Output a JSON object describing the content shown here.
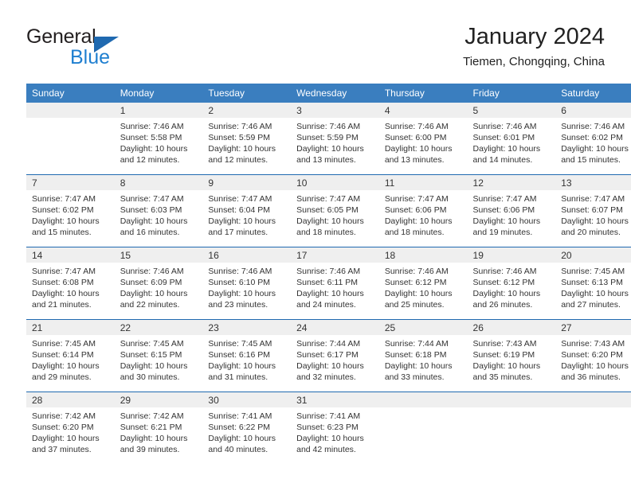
{
  "brand": {
    "name_part1": "General",
    "name_part2": "Blue",
    "triangle_color": "#1f69b0",
    "blue_color": "#1f7fd0"
  },
  "header": {
    "title": "January 2024",
    "subtitle": "Tiemen, Chongqing, China"
  },
  "theme": {
    "header_row_bg": "#3a7ebf",
    "header_row_text": "#ffffff",
    "daynum_band_bg": "#efefef",
    "row_divider": "#1f69b0",
    "body_text": "#333333"
  },
  "weekday_headers": [
    "Sunday",
    "Monday",
    "Tuesday",
    "Wednesday",
    "Thursday",
    "Friday",
    "Saturday"
  ],
  "weeks": [
    [
      {
        "day": "",
        "sunrise": "",
        "sunset": "",
        "daylight_line1": "",
        "daylight_line2": "",
        "empty": true
      },
      {
        "day": "1",
        "sunrise": "Sunrise: 7:46 AM",
        "sunset": "Sunset: 5:58 PM",
        "daylight_line1": "Daylight: 10 hours",
        "daylight_line2": "and 12 minutes.",
        "empty": false
      },
      {
        "day": "2",
        "sunrise": "Sunrise: 7:46 AM",
        "sunset": "Sunset: 5:59 PM",
        "daylight_line1": "Daylight: 10 hours",
        "daylight_line2": "and 12 minutes.",
        "empty": false
      },
      {
        "day": "3",
        "sunrise": "Sunrise: 7:46 AM",
        "sunset": "Sunset: 5:59 PM",
        "daylight_line1": "Daylight: 10 hours",
        "daylight_line2": "and 13 minutes.",
        "empty": false
      },
      {
        "day": "4",
        "sunrise": "Sunrise: 7:46 AM",
        "sunset": "Sunset: 6:00 PM",
        "daylight_line1": "Daylight: 10 hours",
        "daylight_line2": "and 13 minutes.",
        "empty": false
      },
      {
        "day": "5",
        "sunrise": "Sunrise: 7:46 AM",
        "sunset": "Sunset: 6:01 PM",
        "daylight_line1": "Daylight: 10 hours",
        "daylight_line2": "and 14 minutes.",
        "empty": false
      },
      {
        "day": "6",
        "sunrise": "Sunrise: 7:46 AM",
        "sunset": "Sunset: 6:02 PM",
        "daylight_line1": "Daylight: 10 hours",
        "daylight_line2": "and 15 minutes.",
        "empty": false
      }
    ],
    [
      {
        "day": "7",
        "sunrise": "Sunrise: 7:47 AM",
        "sunset": "Sunset: 6:02 PM",
        "daylight_line1": "Daylight: 10 hours",
        "daylight_line2": "and 15 minutes.",
        "empty": false
      },
      {
        "day": "8",
        "sunrise": "Sunrise: 7:47 AM",
        "sunset": "Sunset: 6:03 PM",
        "daylight_line1": "Daylight: 10 hours",
        "daylight_line2": "and 16 minutes.",
        "empty": false
      },
      {
        "day": "9",
        "sunrise": "Sunrise: 7:47 AM",
        "sunset": "Sunset: 6:04 PM",
        "daylight_line1": "Daylight: 10 hours",
        "daylight_line2": "and 17 minutes.",
        "empty": false
      },
      {
        "day": "10",
        "sunrise": "Sunrise: 7:47 AM",
        "sunset": "Sunset: 6:05 PM",
        "daylight_line1": "Daylight: 10 hours",
        "daylight_line2": "and 18 minutes.",
        "empty": false
      },
      {
        "day": "11",
        "sunrise": "Sunrise: 7:47 AM",
        "sunset": "Sunset: 6:06 PM",
        "daylight_line1": "Daylight: 10 hours",
        "daylight_line2": "and 18 minutes.",
        "empty": false
      },
      {
        "day": "12",
        "sunrise": "Sunrise: 7:47 AM",
        "sunset": "Sunset: 6:06 PM",
        "daylight_line1": "Daylight: 10 hours",
        "daylight_line2": "and 19 minutes.",
        "empty": false
      },
      {
        "day": "13",
        "sunrise": "Sunrise: 7:47 AM",
        "sunset": "Sunset: 6:07 PM",
        "daylight_line1": "Daylight: 10 hours",
        "daylight_line2": "and 20 minutes.",
        "empty": false
      }
    ],
    [
      {
        "day": "14",
        "sunrise": "Sunrise: 7:47 AM",
        "sunset": "Sunset: 6:08 PM",
        "daylight_line1": "Daylight: 10 hours",
        "daylight_line2": "and 21 minutes.",
        "empty": false
      },
      {
        "day": "15",
        "sunrise": "Sunrise: 7:46 AM",
        "sunset": "Sunset: 6:09 PM",
        "daylight_line1": "Daylight: 10 hours",
        "daylight_line2": "and 22 minutes.",
        "empty": false
      },
      {
        "day": "16",
        "sunrise": "Sunrise: 7:46 AM",
        "sunset": "Sunset: 6:10 PM",
        "daylight_line1": "Daylight: 10 hours",
        "daylight_line2": "and 23 minutes.",
        "empty": false
      },
      {
        "day": "17",
        "sunrise": "Sunrise: 7:46 AM",
        "sunset": "Sunset: 6:11 PM",
        "daylight_line1": "Daylight: 10 hours",
        "daylight_line2": "and 24 minutes.",
        "empty": false
      },
      {
        "day": "18",
        "sunrise": "Sunrise: 7:46 AM",
        "sunset": "Sunset: 6:12 PM",
        "daylight_line1": "Daylight: 10 hours",
        "daylight_line2": "and 25 minutes.",
        "empty": false
      },
      {
        "day": "19",
        "sunrise": "Sunrise: 7:46 AM",
        "sunset": "Sunset: 6:12 PM",
        "daylight_line1": "Daylight: 10 hours",
        "daylight_line2": "and 26 minutes.",
        "empty": false
      },
      {
        "day": "20",
        "sunrise": "Sunrise: 7:45 AM",
        "sunset": "Sunset: 6:13 PM",
        "daylight_line1": "Daylight: 10 hours",
        "daylight_line2": "and 27 minutes.",
        "empty": false
      }
    ],
    [
      {
        "day": "21",
        "sunrise": "Sunrise: 7:45 AM",
        "sunset": "Sunset: 6:14 PM",
        "daylight_line1": "Daylight: 10 hours",
        "daylight_line2": "and 29 minutes.",
        "empty": false
      },
      {
        "day": "22",
        "sunrise": "Sunrise: 7:45 AM",
        "sunset": "Sunset: 6:15 PM",
        "daylight_line1": "Daylight: 10 hours",
        "daylight_line2": "and 30 minutes.",
        "empty": false
      },
      {
        "day": "23",
        "sunrise": "Sunrise: 7:45 AM",
        "sunset": "Sunset: 6:16 PM",
        "daylight_line1": "Daylight: 10 hours",
        "daylight_line2": "and 31 minutes.",
        "empty": false
      },
      {
        "day": "24",
        "sunrise": "Sunrise: 7:44 AM",
        "sunset": "Sunset: 6:17 PM",
        "daylight_line1": "Daylight: 10 hours",
        "daylight_line2": "and 32 minutes.",
        "empty": false
      },
      {
        "day": "25",
        "sunrise": "Sunrise: 7:44 AM",
        "sunset": "Sunset: 6:18 PM",
        "daylight_line1": "Daylight: 10 hours",
        "daylight_line2": "and 33 minutes.",
        "empty": false
      },
      {
        "day": "26",
        "sunrise": "Sunrise: 7:43 AM",
        "sunset": "Sunset: 6:19 PM",
        "daylight_line1": "Daylight: 10 hours",
        "daylight_line2": "and 35 minutes.",
        "empty": false
      },
      {
        "day": "27",
        "sunrise": "Sunrise: 7:43 AM",
        "sunset": "Sunset: 6:20 PM",
        "daylight_line1": "Daylight: 10 hours",
        "daylight_line2": "and 36 minutes.",
        "empty": false
      }
    ],
    [
      {
        "day": "28",
        "sunrise": "Sunrise: 7:42 AM",
        "sunset": "Sunset: 6:20 PM",
        "daylight_line1": "Daylight: 10 hours",
        "daylight_line2": "and 37 minutes.",
        "empty": false
      },
      {
        "day": "29",
        "sunrise": "Sunrise: 7:42 AM",
        "sunset": "Sunset: 6:21 PM",
        "daylight_line1": "Daylight: 10 hours",
        "daylight_line2": "and 39 minutes.",
        "empty": false
      },
      {
        "day": "30",
        "sunrise": "Sunrise: 7:41 AM",
        "sunset": "Sunset: 6:22 PM",
        "daylight_line1": "Daylight: 10 hours",
        "daylight_line2": "and 40 minutes.",
        "empty": false
      },
      {
        "day": "31",
        "sunrise": "Sunrise: 7:41 AM",
        "sunset": "Sunset: 6:23 PM",
        "daylight_line1": "Daylight: 10 hours",
        "daylight_line2": "and 42 minutes.",
        "empty": false
      },
      {
        "day": "",
        "sunrise": "",
        "sunset": "",
        "daylight_line1": "",
        "daylight_line2": "",
        "empty": true
      },
      {
        "day": "",
        "sunrise": "",
        "sunset": "",
        "daylight_line1": "",
        "daylight_line2": "",
        "empty": true
      },
      {
        "day": "",
        "sunrise": "",
        "sunset": "",
        "daylight_line1": "",
        "daylight_line2": "",
        "empty": true
      }
    ]
  ]
}
